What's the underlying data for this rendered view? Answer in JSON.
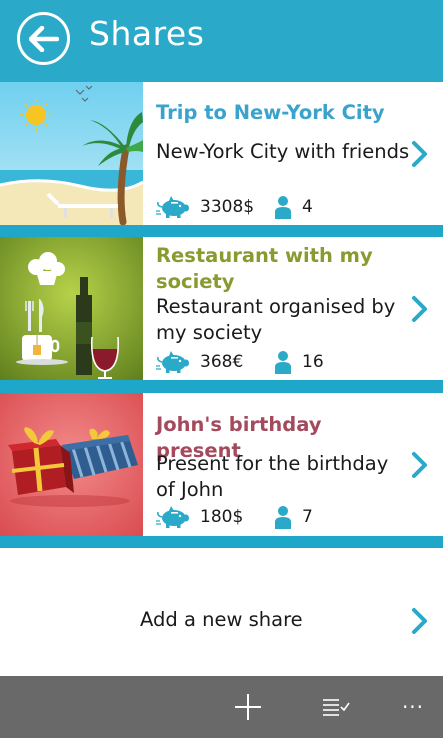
{
  "header": {
    "title": "Shares",
    "back_icon": "arrow-left-icon"
  },
  "shares": [
    {
      "title": "Trip to New-York City",
      "description": "New-York City with friends",
      "amount": "3308$",
      "participants": "4",
      "title_color": "#3aa3cc",
      "image": "beach-palm-illustration"
    },
    {
      "title": "Restaurant with my society",
      "description": "Restaurant organised by my society",
      "amount": "368€",
      "participants": "16",
      "title_color": "#8a9a2f",
      "image": "restaurant-wine-illustration"
    },
    {
      "title": "John's birthday present",
      "description": "Present for the birthday of John",
      "amount": "180$",
      "participants": "7",
      "title_color": "#a44a5c",
      "image": "gift-boxes-illustration"
    }
  ],
  "add_share": {
    "label": "Add a new share"
  },
  "appbar": {
    "icons": [
      "add-icon",
      "list-select-icon",
      "more-icon"
    ],
    "more_label": "···"
  },
  "colors": {
    "accent": "#2aa9c8",
    "appbar": "#696969",
    "chevron": "#2aa9c8"
  }
}
